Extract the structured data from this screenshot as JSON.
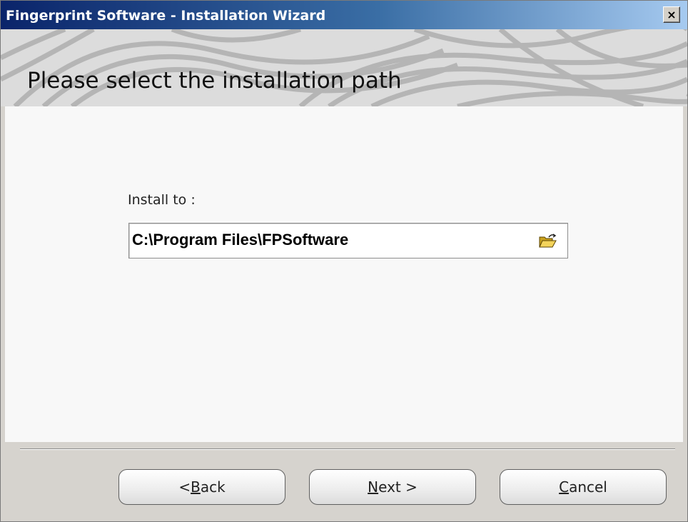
{
  "window": {
    "title": "Fingerprint Software - Installation Wizard",
    "close_label": "×"
  },
  "banner": {
    "title": "Please select the installation path"
  },
  "form": {
    "install_label": "Install to :",
    "path_value": "C:\\Program Files\\FPSoftware",
    "browse_icon": "open-folder-icon"
  },
  "buttons": {
    "back": {
      "prefix": "< ",
      "mnemonic": "B",
      "rest": "ack"
    },
    "next": {
      "prefix": "",
      "mnemonic": "N",
      "rest": "ext >"
    },
    "cancel": {
      "prefix": "",
      "mnemonic": "C",
      "rest": "ancel"
    }
  },
  "colors": {
    "titlebar_start": "#0a246a",
    "titlebar_end": "#a6caf0",
    "window_bg": "#d6d3ce",
    "content_bg": "#f8f8f8"
  }
}
